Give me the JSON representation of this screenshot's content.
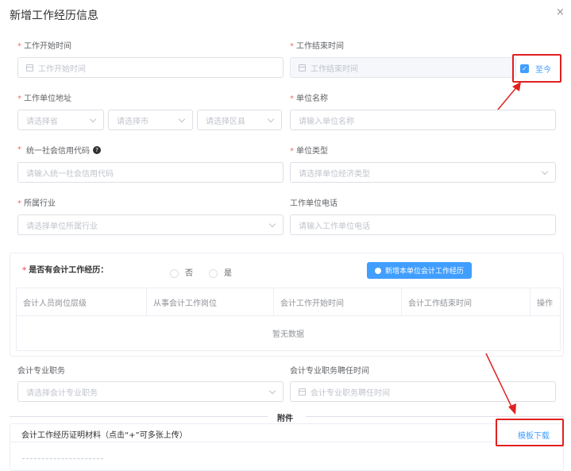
{
  "dialog": {
    "title": "新增工作经历信息",
    "close_icon": "×"
  },
  "form": {
    "start_time": {
      "label": "工作开始时间",
      "placeholder": "工作开始时间"
    },
    "end_time": {
      "label": "工作结束时间",
      "placeholder": "工作结束时间",
      "until_now_label": "至今",
      "until_now_checked": true
    },
    "address": {
      "label": "工作单位地址",
      "province": "请选择省",
      "city": "请选择市",
      "district": "请选择区县"
    },
    "unit_name": {
      "label": "单位名称",
      "placeholder": "请输入单位名称"
    },
    "credit_code": {
      "label": "统一社会信用代码",
      "placeholder": "请输入统一社会信用代码"
    },
    "unit_type": {
      "label": "单位类型",
      "placeholder": "请选择单位经济类型"
    },
    "industry": {
      "label": "所属行业",
      "placeholder": "请选择单位所属行业"
    },
    "unit_phone": {
      "label": "工作单位电话",
      "placeholder": "请输入工作单位电话"
    }
  },
  "accounting": {
    "question": "是否有会计工作经历：",
    "options": [
      "否",
      "是"
    ],
    "add_button": "新增本单位会计工作经历",
    "columns": [
      "会计人员岗位层级",
      "从事会计工作岗位",
      "会计工作开始时间",
      "会计工作结束时间",
      "操作"
    ],
    "empty_text": "暂无数据"
  },
  "title_info": {
    "position": {
      "label": "会计专业职务",
      "placeholder": "请选择会计专业职务"
    },
    "appoint_time": {
      "label": "会计专业职务聘任时间",
      "placeholder": "会计专业职务聘任时间"
    }
  },
  "attachments": {
    "divider": "附件",
    "material_title": "会计工作经历证明材料（点击“+”可多张上传）",
    "template_download": "模板下载"
  },
  "colors": {
    "primary": "#409eff",
    "required": "#f56c6c",
    "annotation": "#e02020"
  }
}
